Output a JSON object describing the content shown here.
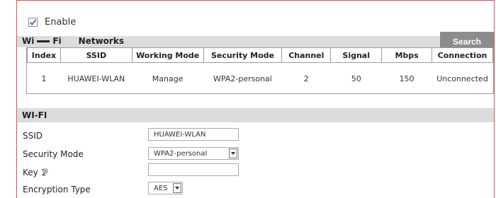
{
  "enable": {
    "label": "Enable",
    "checked": true
  },
  "networks": {
    "title_prefix": "Wi",
    "title_suffix": "Fi",
    "title_label": "Networks",
    "search_label": "Search",
    "columns": [
      "Index",
      "SSID",
      "Working Mode",
      "Security Mode",
      "Channel",
      "Signal",
      "Mbps",
      "Connection"
    ],
    "rows": [
      [
        "1",
        "HUAWEI-WLAN",
        "Manage",
        "WPA2-personal",
        "2",
        "50",
        "150",
        "Unconnected"
      ]
    ]
  },
  "wifi": {
    "title": "WI-FI",
    "ssid": {
      "label": "SSID",
      "value": "HUAWEI-WLAN"
    },
    "security_mode": {
      "label": "Security Mode",
      "value": "WPA2-personal"
    },
    "key1": {
      "label": "Key 1",
      "value": ""
    },
    "encryption_type": {
      "label": "Encryption Type",
      "value": "AES"
    }
  },
  "colors": {
    "frame_border": "#d9534f",
    "band": "#dcdcdc",
    "search_button": "#8c8c8c"
  }
}
